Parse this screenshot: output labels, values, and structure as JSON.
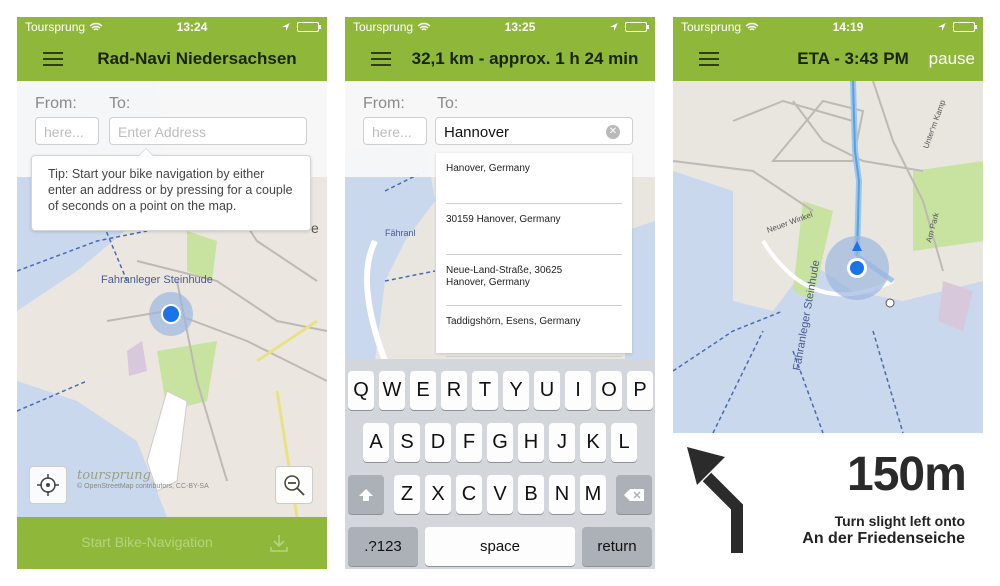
{
  "screens": [
    {
      "status": {
        "carrier": "Toursprung",
        "time": "13:24"
      },
      "title": "Rad-Navi Niedersachsen",
      "from_label": "From:",
      "to_label": "To:",
      "from_placeholder": "here...",
      "to_placeholder": "Enter Address",
      "tip": "Tip: Start your bike navigation by either enter an address or by pressing for a couple of seconds on a point on the map.",
      "map_label": "Fahranleger Steinhude",
      "logo": "toursprung",
      "attribution": "© OpenStreetMap contributors, CC-BY-SA",
      "start_button": "Start Bike-Navigation",
      "icons": [
        "menu-icon",
        "locate-icon",
        "zoom-out-icon",
        "download-icon"
      ]
    },
    {
      "status": {
        "carrier": "Toursprung",
        "time": "13:25"
      },
      "title": "32,1 km - approx. 1 h 24 min",
      "from_label": "From:",
      "to_label": "To:",
      "from_placeholder": "here...",
      "to_value": "Hannover",
      "suggestions": [
        {
          "line1": "Hanover, Germany",
          "line2": ""
        },
        {
          "line1": "30159 Hanover, Germany",
          "line2": ""
        },
        {
          "line1": "Neue-Land-Straße, 30625",
          "line2": "Hanover, Germany"
        },
        {
          "line1": "Taddigshörn, Esens, Germany",
          "line2": ""
        }
      ],
      "map_label": "Fähranl",
      "keyboard": {
        "row1": [
          "Q",
          "W",
          "E",
          "R",
          "T",
          "Y",
          "U",
          "I",
          "O",
          "P"
        ],
        "row2": [
          "A",
          "S",
          "D",
          "F",
          "G",
          "H",
          "J",
          "K",
          "L"
        ],
        "row3": [
          "Z",
          "X",
          "C",
          "V",
          "B",
          "N",
          "M"
        ],
        "numbers_key": ".?123",
        "space_key": "space",
        "return_key": "return"
      }
    },
    {
      "status": {
        "carrier": "Toursprung",
        "time": "14:19"
      },
      "title": "ETA - 3:43 PM",
      "pause_label": "pause",
      "map_labels": [
        "Fähranleger Steinhude",
        "Neuer Winkel",
        "Unter'm Kamp",
        "Am Park"
      ],
      "distance": "150m",
      "instruction_line1": "Turn slight left onto",
      "instruction_line2": "An der Friedenseiche"
    }
  ],
  "colors": {
    "accent": "#8fb83b",
    "water": "#c9d8ec",
    "park": "#c8e2a0",
    "location": "#1a73e8"
  }
}
